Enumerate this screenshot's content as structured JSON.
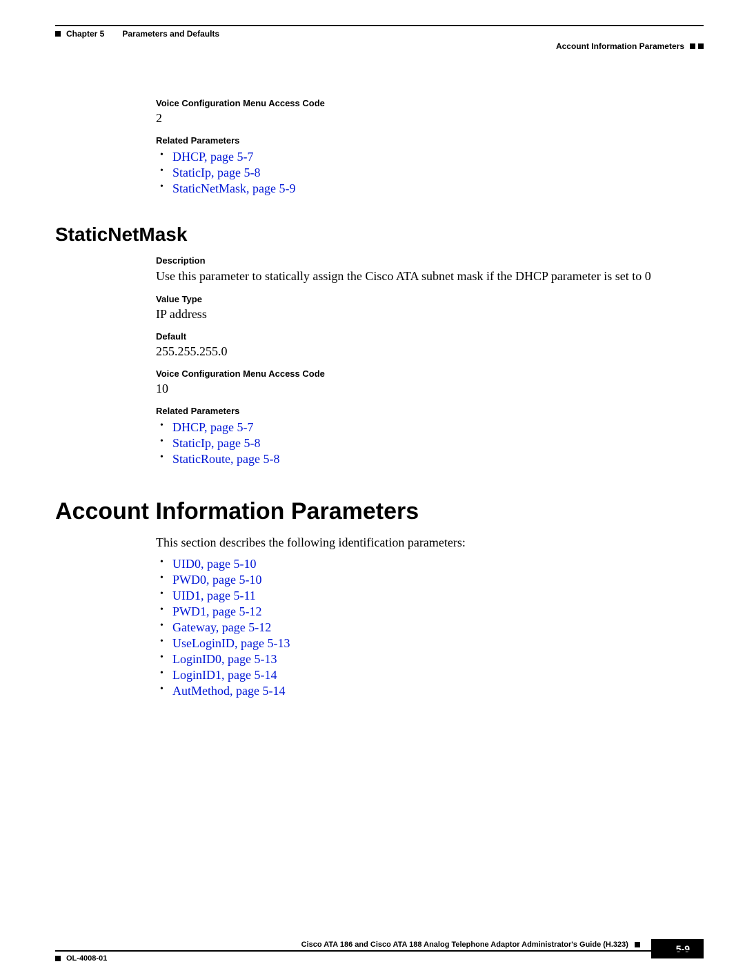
{
  "header": {
    "chapter_label": "Chapter 5",
    "chapter_title": "Parameters and Defaults",
    "section_title": "Account Information Parameters"
  },
  "section1": {
    "vcm_label": "Voice Configuration Menu Access Code",
    "vcm_value": "2",
    "related_label": "Related Parameters",
    "links": [
      "DHCP, page 5-7",
      "StaticIp, page 5-8",
      "StaticNetMask, page 5-9"
    ]
  },
  "staticnetmask": {
    "heading": "StaticNetMask",
    "description_label": "Description",
    "description_text": "Use this parameter to statically assign the Cisco ATA subnet mask if the DHCP parameter is set to 0",
    "value_type_label": "Value Type",
    "value_type_value": "IP address",
    "default_label": "Default",
    "default_value": "255.255.255.0",
    "vcm_label": "Voice Configuration Menu Access Code",
    "vcm_value": "10",
    "related_label": "Related Parameters",
    "links": [
      "DHCP, page 5-7",
      "StaticIp, page 5-8",
      "StaticRoute, page 5-8"
    ]
  },
  "account": {
    "heading": "Account Information Parameters",
    "intro": "This section describes the following identification parameters:",
    "links": [
      "UID0, page 5-10",
      "PWD0, page 5-10",
      "UID1, page 5-11",
      "PWD1, page 5-12",
      "Gateway, page 5-12",
      "UseLoginID, page 5-13",
      "LoginID0, page 5-13",
      "LoginID1, page 5-14",
      "AutMethod, page 5-14"
    ]
  },
  "footer": {
    "guide_title": "Cisco ATA 186 and Cisco ATA 188 Analog Telephone Adaptor Administrator's Guide (H.323)",
    "doc_id": "OL-4008-01",
    "page_number": "5-9"
  }
}
